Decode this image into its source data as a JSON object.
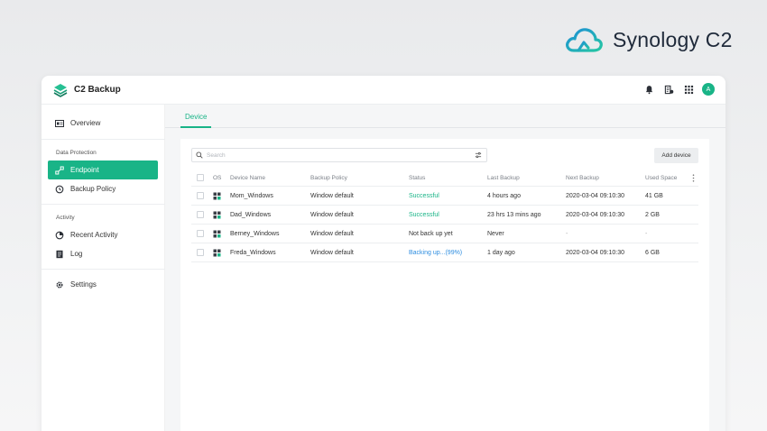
{
  "brand": {
    "name": "Synology C2"
  },
  "app": {
    "title": "C2 Backup",
    "avatar_initial": "A"
  },
  "colors": {
    "accent": "#19b487",
    "progress": "#2f8ee0"
  },
  "topbar_icons": [
    "bell-icon",
    "notes-icon",
    "apps-grid-icon"
  ],
  "sidebar": {
    "overview": "Overview",
    "group_data_protection": "Data Protection",
    "endpoint": "Endpoint",
    "backup_policy": "Backup Policy",
    "group_activity": "Activity",
    "recent_activity": "Recent Activity",
    "log": "Log",
    "settings": "Settings"
  },
  "tabs": {
    "device": "Device"
  },
  "toolbar": {
    "search_placeholder": "Search",
    "add_device": "Add device"
  },
  "table": {
    "headers": {
      "os": "OS",
      "device_name": "Device Name",
      "backup_policy": "Backup Policy",
      "status": "Status",
      "last_backup": "Last Backup",
      "next_backup": "Next Backup",
      "used_space": "Used Space"
    },
    "rows": [
      {
        "device_name": "Mom_Windows",
        "backup_policy": "Window default",
        "status": "Successful",
        "last_backup": "4 hours  ago",
        "next_backup": "2020-03-04 09:10:30",
        "used_space": "41 GB"
      },
      {
        "device_name": "Dad_Windows",
        "backup_policy": "Window default",
        "status": "Successful",
        "last_backup": "23 hrs 13 mins ago",
        "next_backup": "2020-03-04 09:10:30",
        "used_space": "2 GB"
      },
      {
        "device_name": "Berney_Windows",
        "backup_policy": "Window default",
        "status": "Not back up yet",
        "last_backup": "Never",
        "next_backup": "-",
        "used_space": "-"
      },
      {
        "device_name": "Freda_Windows",
        "backup_policy": "Window default",
        "status": "Backing up...(99%)",
        "last_backup": "1 day ago",
        "next_backup": "2020-03-04 09:10:30",
        "used_space": "6 GB"
      }
    ]
  }
}
